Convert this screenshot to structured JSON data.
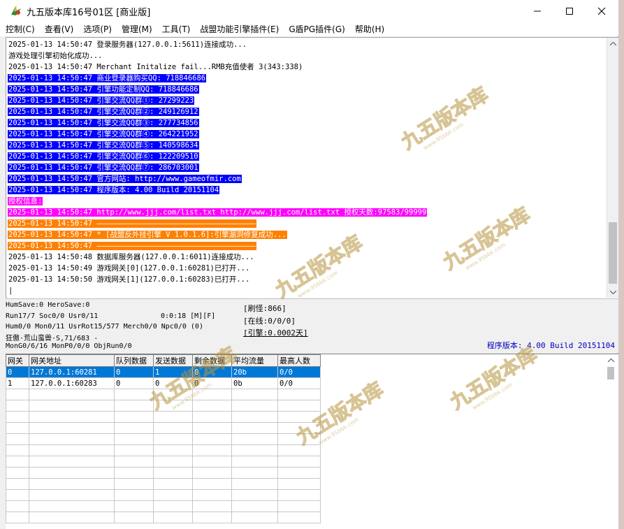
{
  "window": {
    "title": "九五版本库16号01区 [商业版]",
    "controls": {
      "minimize": "—",
      "maximize": "☐",
      "close": "✕"
    }
  },
  "menu": [
    "控制(C)",
    "查看(V)",
    "选项(P)",
    "管理(M)",
    "工具(T)",
    "战盟功能引擎插件(E)",
    "G盾PG插件(G)",
    "帮助(H)"
  ],
  "colors": {
    "blue_bg": "#0000ff",
    "magenta_bg": "#ff00ff",
    "orange_bg": "#ff8000",
    "selected_row": "#0078d7",
    "version_text": "#0000c0"
  },
  "log": [
    {
      "text": "2025-01-13 14:50:47 登录服务器(127.0.0.1:5611)连接成功...",
      "style": "plain"
    },
    {
      "text": "游戏处理引擎初始化成功...",
      "style": "plain"
    },
    {
      "text": "2025-01-13 14:50:47 Merchant Initalize fail...RMB充值使者 3(343:338)",
      "style": "plain"
    },
    {
      "text": "2025-01-13 14:50:47 商业登录器购买QQ: 718846686",
      "style": "blue"
    },
    {
      "text": "2025-01-13 14:50:47 引擎功能定制QQ: 718846686",
      "style": "blue"
    },
    {
      "text": "2025-01-13 14:50:47 引擎交流QQ群①: 27299223",
      "style": "blue"
    },
    {
      "text": "2025-01-13 14:50:47 引擎交流QQ群②: 249126912",
      "style": "blue"
    },
    {
      "text": "2025-01-13 14:50:47 引擎交流QQ群③: 277734856",
      "style": "blue"
    },
    {
      "text": "2025-01-13 14:50:47 引擎交流QQ群④: 264221952",
      "style": "blue"
    },
    {
      "text": "2025-01-13 14:50:47 引擎交流QQ群⑤: 140598634",
      "style": "blue"
    },
    {
      "text": "2025-01-13 14:50:47 引擎交流QQ群⑥: 122209510",
      "style": "blue"
    },
    {
      "text": "2025-01-13 14:50:47 引擎交流QQ群⑦: 286703001",
      "style": "blue"
    },
    {
      "text": "2025-01-13 14:50:47 官方网站: http://www.gameofmir.com",
      "style": "blue"
    },
    {
      "text": "2025-01-13 14:50:47 程序版本: 4.00 Build 20151104",
      "style": "blue"
    },
    {
      "text": "授权信息:",
      "style": "magenta"
    },
    {
      "text": "2025-01-13 14:50:47 http://www.jjj.com/list.txt http://www.jjj.com/list.txt 授权天数:97583/99999",
      "style": "magenta"
    },
    {
      "text": "2025-01-13 14:50:47 ————————————————————————————————————",
      "style": "orange"
    },
    {
      "text": "2025-01-13 14:50:47 * [战盟反外挂引擎 V 1.0.1.6]:引擎漏洞修复成功...",
      "style": "orange"
    },
    {
      "text": "2025-01-13 14:50:47 ————————————————————————————————————",
      "style": "orange"
    },
    {
      "text": "2025-01-13 14:50:48 数据库服务器(127.0.0.1:6011)连接成功...",
      "style": "plain"
    },
    {
      "text": "2025-01-13 14:50:49 游戏网关[0](127.0.0.1:60281)已打开...",
      "style": "plain"
    },
    {
      "text": "2025-01-13 14:50:50 游戏网关[1](127.0.0.1:60283)已打开...",
      "style": "plain"
    },
    {
      "text": "|",
      "style": "plain"
    }
  ],
  "status": {
    "line1": "HumSave:0 HeroSave:0",
    "line2": "Run17/7 Soc0/0 Usr0/11",
    "timer": "0:0:18 [M][F]",
    "line3": "Hum0/0 Mon0/11 UsrRot15/577 Merch0/0 Npc0/0 (0)",
    "line4": "狂傲·荒山蛮兽·S,71/683 -",
    "line5": "MonG0/6/16 MonP0/0/0 ObjRun0/0",
    "monster": "[刷怪:866]",
    "online": "[在线:0/0/0]",
    "engine": "[引擎:0.0002天]",
    "version": "程序版本: 4.00 Build 20151104"
  },
  "grid": {
    "headers": [
      "网关",
      "网关地址",
      "队列数据",
      "发送数据",
      "剩余数据",
      "平均流量",
      "最高人数"
    ],
    "rows": [
      [
        "0",
        "127.0.0.1:60281",
        "0",
        "1",
        "0",
        "20b",
        "0/0"
      ],
      [
        "1",
        "127.0.0.1:60283",
        "0",
        "0",
        "0",
        "0b",
        "0/0"
      ]
    ],
    "selected_row": 0
  },
  "watermark": {
    "text": "九五版本库",
    "subtext": "www.95bbk.com"
  }
}
